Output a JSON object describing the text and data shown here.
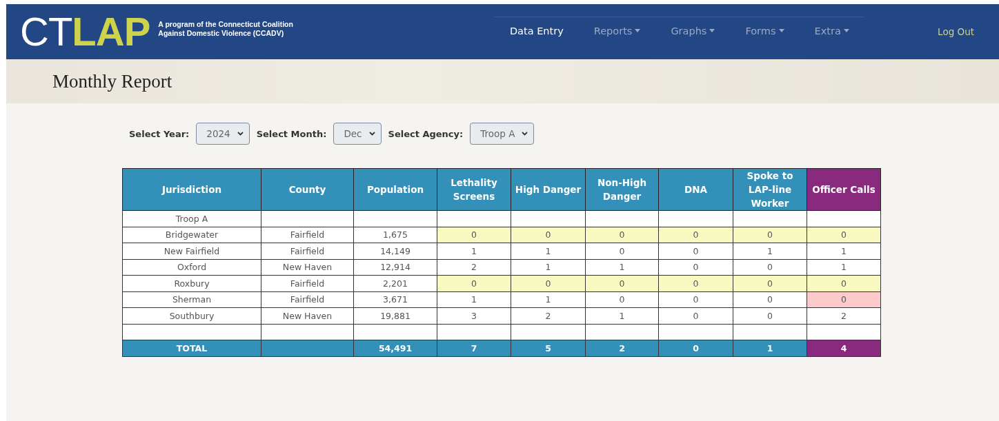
{
  "header": {
    "logo": {
      "part_1": "CT",
      "part_2": "LAP"
    },
    "tagline": [
      "A program of the Connecticut Coalition",
      "Against Domestic Violence (CCADV)"
    ],
    "nav": [
      {
        "label": "Data Entry",
        "selected": true,
        "dropdown": false
      },
      {
        "label": "Reports",
        "selected": false,
        "dropdown": true
      },
      {
        "label": "Graphs",
        "selected": false,
        "dropdown": true
      },
      {
        "label": "Forms",
        "selected": false,
        "dropdown": true
      },
      {
        "label": "Extra",
        "selected": false,
        "dropdown": true
      }
    ],
    "logout": "Log Out"
  },
  "page_title": "Monthly Report",
  "filters": [
    {
      "label": "Select Year:",
      "value": "2024"
    },
    {
      "label": "Select Month:",
      "value": "Dec"
    },
    {
      "label": "Select Agency:",
      "value": "Troop A"
    }
  ],
  "table": {
    "columns": [
      {
        "label": "Jurisdiction",
        "color": "#3390b8"
      },
      {
        "label": "County",
        "color": "#3390b8"
      },
      {
        "label": "Population",
        "color": "#3390b8"
      },
      {
        "label": "Lethality Screens",
        "color": "#3390b8"
      },
      {
        "label": "High Danger",
        "color": "#3390b8"
      },
      {
        "label": "Non-High Danger",
        "color": "#3390b8"
      },
      {
        "label": "DNA",
        "color": "#3390b8"
      },
      {
        "label": "Spoke to LAP-line Worker",
        "color": "#3390b8"
      },
      {
        "label": "Officer Calls",
        "color": "#8a2a7e"
      }
    ],
    "rows": [
      {
        "kind": "group",
        "cells": [
          {
            "text": "Troop A"
          }
        ]
      },
      {
        "cells": [
          {
            "text": "Bridgewater"
          },
          {
            "text": "Fairfield"
          },
          {
            "text": "1,675"
          },
          {
            "text": "0",
            "color": "#f7f9c0"
          },
          {
            "text": "0",
            "color": "#f7f9c0"
          },
          {
            "text": "0",
            "color": "#f7f9c0"
          },
          {
            "text": "0",
            "color": "#f7f9c0"
          },
          {
            "text": "0",
            "color": "#f7f9c0"
          },
          {
            "text": "0",
            "color": "#f7f9c0"
          }
        ]
      },
      {
        "cells": [
          {
            "text": "New Fairfield"
          },
          {
            "text": "Fairfield"
          },
          {
            "text": "14,149"
          },
          {
            "text": "1"
          },
          {
            "text": "1"
          },
          {
            "text": "0"
          },
          {
            "text": "0"
          },
          {
            "text": "1"
          },
          {
            "text": "1"
          }
        ]
      },
      {
        "cells": [
          {
            "text": "Oxford"
          },
          {
            "text": "New Haven"
          },
          {
            "text": "12,914"
          },
          {
            "text": "2"
          },
          {
            "text": "1"
          },
          {
            "text": "1"
          },
          {
            "text": "0"
          },
          {
            "text": "0"
          },
          {
            "text": "1"
          }
        ]
      },
      {
        "cells": [
          {
            "text": "Roxbury"
          },
          {
            "text": "Fairfield"
          },
          {
            "text": "2,201"
          },
          {
            "text": "0",
            "color": "#f7f9c0"
          },
          {
            "text": "0",
            "color": "#f7f9c0"
          },
          {
            "text": "0",
            "color": "#f7f9c0"
          },
          {
            "text": "0",
            "color": "#f7f9c0"
          },
          {
            "text": "0",
            "color": "#f7f9c0"
          },
          {
            "text": "0",
            "color": "#f7f9c0"
          }
        ]
      },
      {
        "cells": [
          {
            "text": "Sherman"
          },
          {
            "text": "Fairfield"
          },
          {
            "text": "3,671"
          },
          {
            "text": "1"
          },
          {
            "text": "1"
          },
          {
            "text": "0"
          },
          {
            "text": "0"
          },
          {
            "text": "0"
          },
          {
            "text": "0",
            "color": "#fccaca"
          }
        ]
      },
      {
        "cells": [
          {
            "text": "Southbury"
          },
          {
            "text": "New Haven"
          },
          {
            "text": "19,881"
          },
          {
            "text": "3"
          },
          {
            "text": "2"
          },
          {
            "text": "1"
          },
          {
            "text": "0"
          },
          {
            "text": "0"
          },
          {
            "text": "2"
          }
        ]
      },
      {
        "kind": "spacer"
      }
    ],
    "total": {
      "label": "TOTAL",
      "values": [
        "54,491",
        "7",
        "5",
        "2",
        "0",
        "1",
        "4"
      ]
    }
  }
}
